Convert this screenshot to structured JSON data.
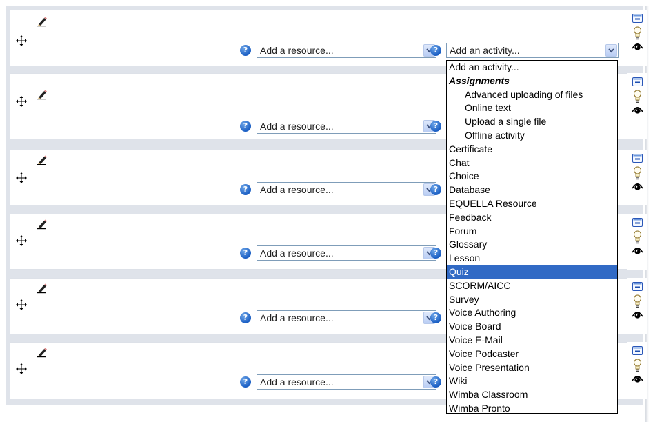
{
  "sections": [
    {
      "resource_placeholder": "Add a resource...",
      "activity_placeholder": "Add an activity..."
    },
    {
      "resource_placeholder": "Add a resource..."
    },
    {
      "resource_placeholder": "Add a resource..."
    },
    {
      "resource_placeholder": "Add a resource..."
    },
    {
      "resource_placeholder": "Add a resource..."
    },
    {
      "resource_placeholder": "Add a resource..."
    }
  ],
  "help_glyph": "?",
  "icons": {
    "move": "move-arrows-icon",
    "edit": "edit-pencil-icon",
    "help": "help-question-icon",
    "collapse": "collapse-box-icon",
    "highlight": "lightbulb-icon",
    "visibility": "eye-icon"
  },
  "dropdown": {
    "items": [
      {
        "label": "Add an activity...",
        "kind": "option"
      },
      {
        "label": "Assignments",
        "kind": "group"
      },
      {
        "label": "Advanced uploading of files",
        "kind": "sub"
      },
      {
        "label": "Online text",
        "kind": "sub"
      },
      {
        "label": "Upload a single file",
        "kind": "sub"
      },
      {
        "label": "Offline activity",
        "kind": "sub"
      },
      {
        "label": "Certificate",
        "kind": "option"
      },
      {
        "label": "Chat",
        "kind": "option"
      },
      {
        "label": "Choice",
        "kind": "option"
      },
      {
        "label": "Database",
        "kind": "option"
      },
      {
        "label": "EQUELLA Resource",
        "kind": "option"
      },
      {
        "label": "Feedback",
        "kind": "option"
      },
      {
        "label": "Forum",
        "kind": "option"
      },
      {
        "label": "Glossary",
        "kind": "option"
      },
      {
        "label": "Lesson",
        "kind": "option"
      },
      {
        "label": "Quiz",
        "kind": "option",
        "selected": true
      },
      {
        "label": "SCORM/AICC",
        "kind": "option"
      },
      {
        "label": "Survey",
        "kind": "option"
      },
      {
        "label": "Voice Authoring",
        "kind": "option"
      },
      {
        "label": "Voice Board",
        "kind": "option"
      },
      {
        "label": "Voice E-Mail",
        "kind": "option"
      },
      {
        "label": "Voice Podcaster",
        "kind": "option"
      },
      {
        "label": "Voice Presentation",
        "kind": "option"
      },
      {
        "label": "Wiki",
        "kind": "option"
      },
      {
        "label": "Wimba Classroom",
        "kind": "option"
      },
      {
        "label": "Wimba Pronto",
        "kind": "option"
      }
    ]
  },
  "colors": {
    "selection": "#316ac5",
    "help_blue": "#1b5fc4",
    "frame": "#dfe3ea"
  }
}
